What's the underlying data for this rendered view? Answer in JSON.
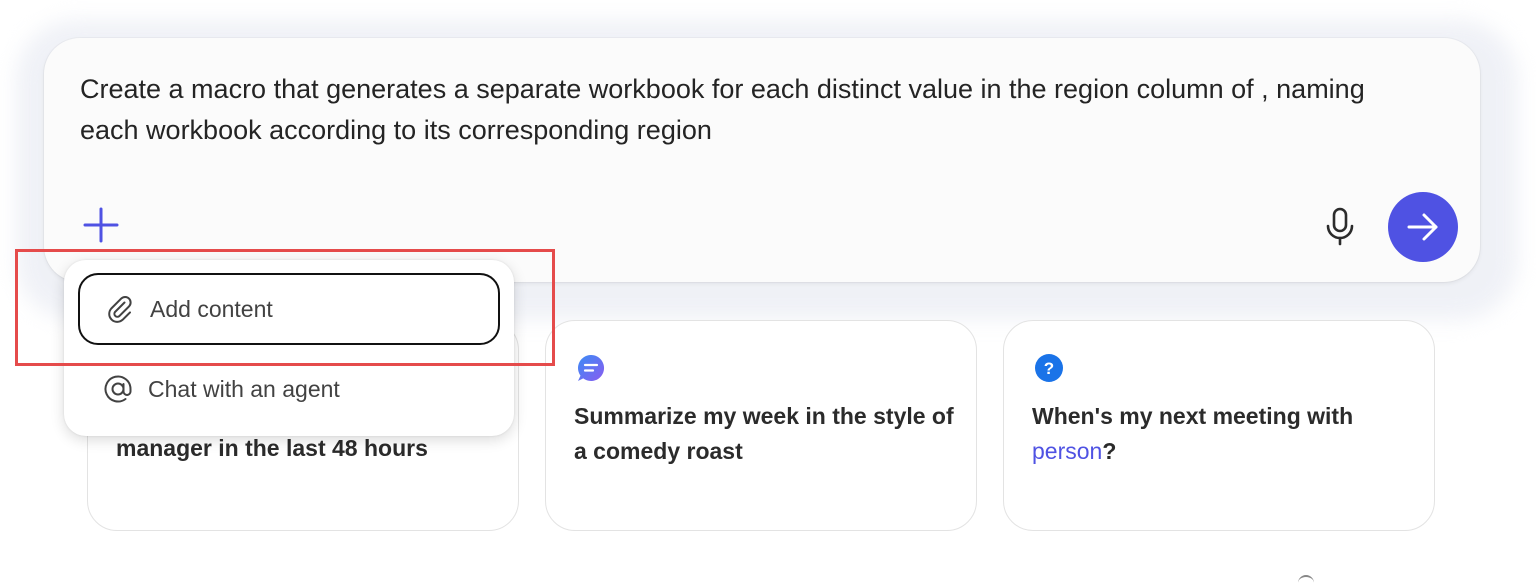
{
  "composer": {
    "prompt_line1": "Create a macro that generates a separate workbook for each distinct value in the region column of , naming",
    "prompt_line2": "each workbook according to its corresponding region",
    "add_icon": "plus-icon",
    "mic_icon": "microphone-icon",
    "send_icon": "arrow-right-icon"
  },
  "menu": {
    "items": [
      {
        "label": "Add content",
        "icon": "paperclip-icon"
      },
      {
        "label": "Chat with an agent",
        "icon": "at-sign-icon"
      }
    ]
  },
  "suggestions": [
    {
      "text": "manager in the last 48 hours",
      "icon": ""
    },
    {
      "text": "Summarize my week in the style of a comedy roast",
      "icon": "chat-bubble-icon"
    },
    {
      "text_before": "When's my next meeting with ",
      "highlight": "person",
      "text_after": "?",
      "icon": "question-icon"
    }
  ],
  "colors": {
    "accent": "#4f52e3",
    "highlight_frame": "#e54b4b",
    "chat_icon_gradient": [
      "#3b8cf5",
      "#8a5cf0"
    ],
    "question_icon": "#1a73e8"
  }
}
